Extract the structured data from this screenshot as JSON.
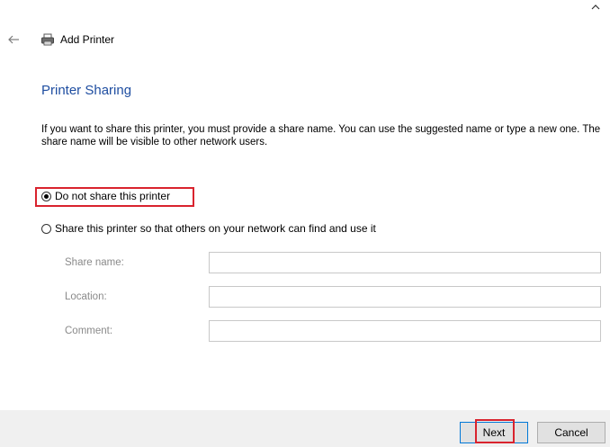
{
  "window": {
    "title": "Add Printer",
    "back_icon": "back-arrow-icon",
    "printer_icon": "printer-icon",
    "collapse_icon": "chevron-up-icon"
  },
  "page": {
    "heading": "Printer Sharing",
    "description": "If you want to share this printer, you must provide a share name. You can use the suggested name or type a new one. The share name will be visible to other network users."
  },
  "sharing_options": [
    {
      "label": "Do not share this printer",
      "selected": true
    },
    {
      "label": "Share this printer so that others on your network can find and use it",
      "selected": false
    }
  ],
  "fields": {
    "share_name": {
      "label": "Share name:",
      "value": ""
    },
    "location": {
      "label": "Location:",
      "value": ""
    },
    "comment": {
      "label": "Comment:",
      "value": ""
    }
  },
  "buttons": {
    "next": "Next",
    "cancel": "Cancel"
  },
  "colors": {
    "heading": "#1f4ea1",
    "highlight": "#d9232e",
    "footer_bg": "#f0f0f0"
  }
}
